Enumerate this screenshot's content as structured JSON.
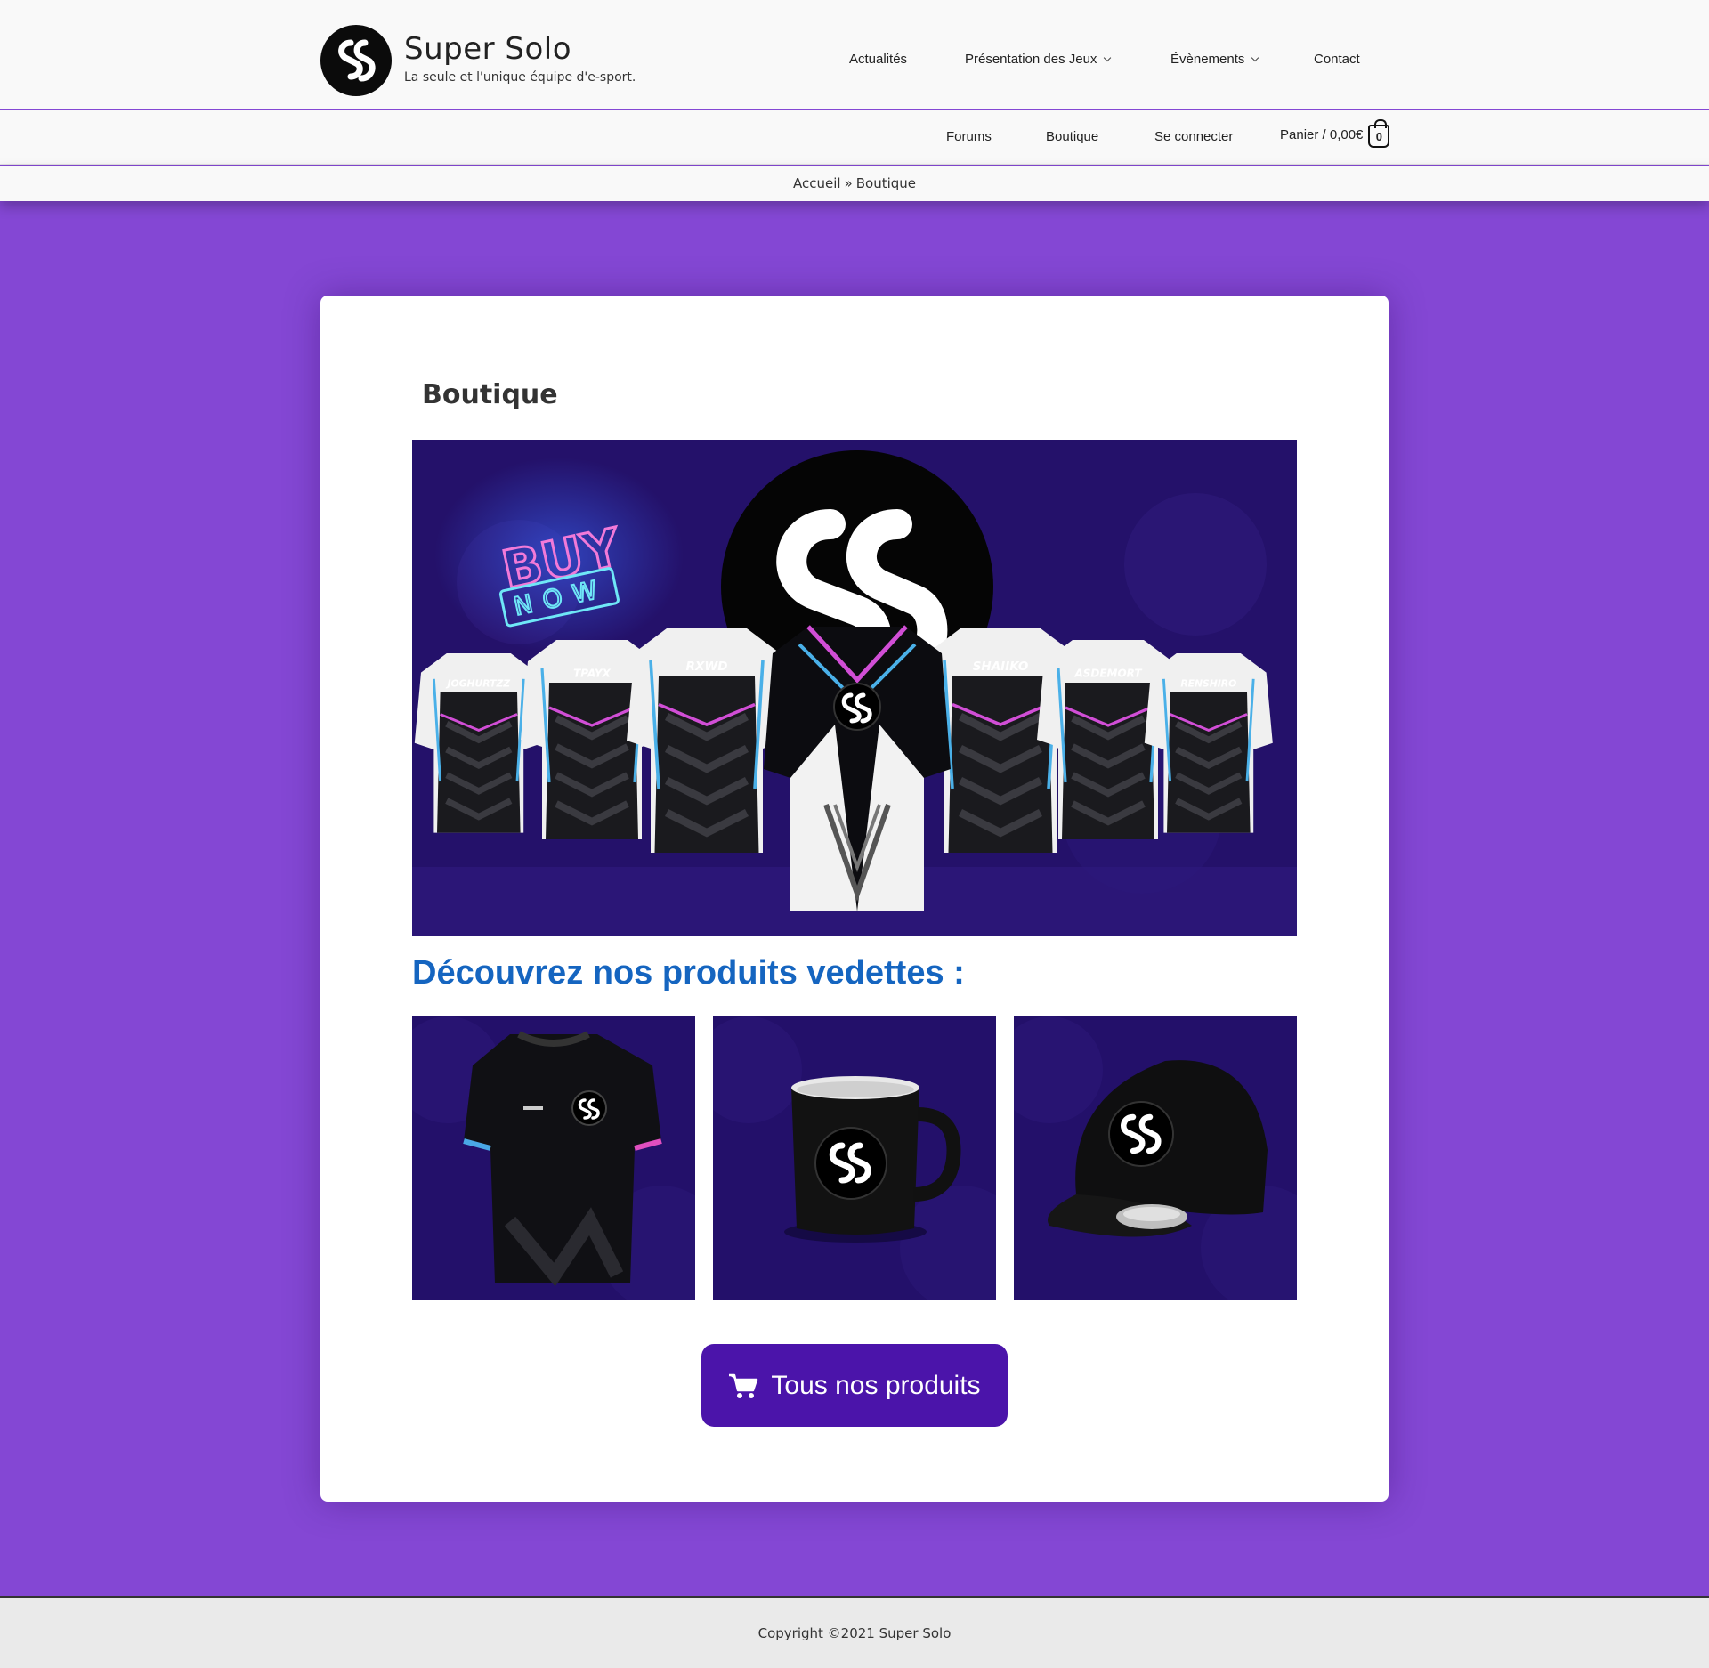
{
  "site": {
    "title": "Super Solo",
    "tagline": "La seule et l'unique équipe d'e-sport."
  },
  "main_nav": {
    "items": [
      {
        "label": "Actualités",
        "has_dropdown": false
      },
      {
        "label": "Présentation des Jeux",
        "has_dropdown": true
      },
      {
        "label": "Évènements",
        "has_dropdown": true
      },
      {
        "label": "Contact",
        "has_dropdown": false
      }
    ]
  },
  "sub_nav": {
    "items": [
      {
        "label": "Forums"
      },
      {
        "label": "Boutique"
      },
      {
        "label": "Se connecter"
      }
    ],
    "cart_label": "Panier / 0,00€",
    "cart_count": "0"
  },
  "breadcrumb": {
    "home": "Accueil",
    "separator": "»",
    "current": "Boutique"
  },
  "page": {
    "title": "Boutique",
    "hero": {
      "neon_top": "BUY",
      "neon_bottom": "NOW",
      "jerseys": [
        "JOGHURTZZ",
        "TPAYX",
        "RXWD",
        "SHAIIKO",
        "ASDEMORT",
        "RENSHIRO"
      ]
    },
    "featured_heading": "Découvrez nos produits vedettes :",
    "products": [
      {
        "name": "t-shirt",
        "icon": "tshirt"
      },
      {
        "name": "mug",
        "icon": "mug"
      },
      {
        "name": "cap",
        "icon": "cap"
      }
    ],
    "cta_label": "Tous nos produits",
    "cta_icon": "shopping-cart-icon"
  },
  "footer": {
    "copyright": "Copyright ©2021 Super Solo"
  },
  "colors": {
    "background": "#8447d4",
    "accent_heading": "#1565c0",
    "cta": "#4b14aa",
    "hero_bg": "#1e0f5c"
  }
}
